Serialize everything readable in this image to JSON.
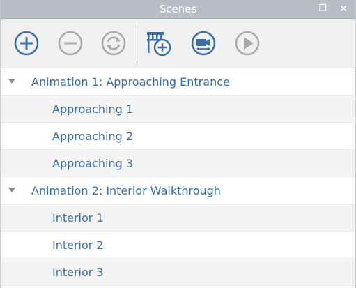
{
  "panel": {
    "title": "Scenes",
    "restore_icon": "restore-icon",
    "close_icon": "close-icon"
  },
  "toolbar": {
    "buttons": [
      {
        "name": "add-animation-button",
        "icon": "plus-circle-icon"
      },
      {
        "name": "remove-button",
        "icon": "minus-circle-icon"
      },
      {
        "name": "refresh-button",
        "icon": "refresh-icon"
      },
      {
        "name": "add-scene-button",
        "icon": "film-plus-icon"
      },
      {
        "name": "camera-button",
        "icon": "camera-icon"
      },
      {
        "name": "play-button",
        "icon": "play-icon"
      }
    ],
    "colors": {
      "accent": "#3a6ea5",
      "disabled": "#a9a9a9"
    }
  },
  "tree": {
    "groups": [
      {
        "label": "Animation 1: Approaching Entrance",
        "children": [
          "Approaching 1",
          "Approaching 2",
          "Approaching 3"
        ]
      },
      {
        "label": "Animation 2: Interior Walkthrough",
        "children": [
          "Interior 1",
          "Interior 2",
          "Interior 3"
        ]
      }
    ]
  }
}
